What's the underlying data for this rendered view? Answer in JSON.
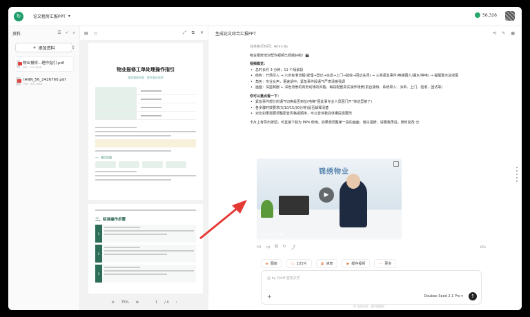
{
  "topbar": {
    "app_title": "论文租房汇报PPT",
    "caret": "▾",
    "credits": "56,326"
  },
  "sources": {
    "title": "资料",
    "add_label": "添加资料",
    "files": [
      {
        "name": "物业报修...理作指引.pdf",
        "meta": "PDF · 123.44KB"
      },
      {
        "name": "IANN_56_2426760.pdf",
        "meta": "PDF · 362.10KB"
      }
    ]
  },
  "viewer": {
    "doc_title": "物业报修工单处理操作指引",
    "doc_sub": "规范报修流程 · 提升服务效率",
    "section1": "一、使用范围",
    "section2": "二、标准操作步骤",
    "zoom": "75%",
    "page_current": "1",
    "page_total": "/ 4"
  },
  "chat": {
    "title": "生成论文综合汇报PPT",
    "time_line": "任务执行时间：4min 6s",
    "intro": "物业报修培训帮你视频已经做好啦！🎬",
    "h1": "视频概览：",
    "overview": [
      "总时长约 3 分钟，11 个场景段",
      "结构：开场引入 → 六步标准流程(受理→登记→派发→上门→验收→回访关闭) → 三类紧急事件(电梯困人/漏水/停电) → 提醒警示总收尾",
      "角色：专业女声，语速适中，紧急事件段语气严肃清晰强调",
      "画面：深蓝制服 + 深色背景的商务动场的风格，每段配套真实操作场景(前台接待、系统录入、派单、上门、验收、回访等)"
    ],
    "h2": "你可以重点看一下：",
    "highlights": [
      "紧急事件部分的语气切换是否到位(电梯“困此事专业人员困门开”待这里被了)",
      "各步骤时效要求(5/10/15/30分钟)是否解释清楚",
      "对比如果需要调整配音风格或顺序，可以告诉我具体哪段需要改"
    ],
    "closing": "卡片上有导出按钮，可直接下载为 MP4 使用。如果想调整某一段的画面、旁白措辞，请跟我再说，随时复改 😊",
    "video": {
      "brand": "锦绣物业",
      "time": "00:00 / 03:08",
      "progress": 0.0
    },
    "percent": "35%",
    "tools": [
      "图库",
      "幻灯片",
      "读表",
      "缓存视频",
      "更多"
    ],
    "placeholder": "@ by Qoiff 查找文件",
    "model": "Doubao Seed 2.1 Pro ▾",
    "footer": "AI 生成内容，请仔细甄别"
  },
  "colors": {
    "accent": "#1e9e6a",
    "arrow": "#e53935"
  }
}
